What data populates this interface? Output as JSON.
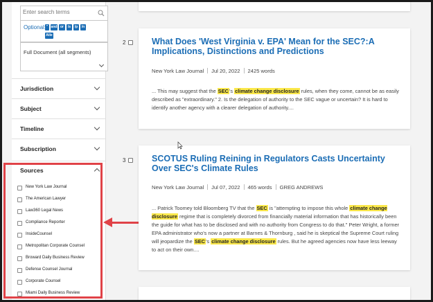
{
  "search": {
    "placeholder": "Enter search terms"
  },
  "operators": {
    "label": "Optional:",
    "chips": [
      "\"",
      "and",
      "or",
      "/s",
      "/p",
      "/n",
      "Atle"
    ]
  },
  "document_scope": {
    "selected": "Full Document (all segments)"
  },
  "facets": [
    "Jurisdiction",
    "Subject",
    "Timeline",
    "Subscription"
  ],
  "sources": {
    "title": "Sources",
    "items": [
      "New York Law Journal",
      "The American Lawyer",
      "Law360 Legal News",
      "Compliance Reporter",
      "InsideCounsel",
      "Metropolitan Corporate Counsel",
      "Broward Daily Business Review",
      "Defense Counsel Journal",
      "Corporate Counsel",
      "Miami Daily Business Review"
    ]
  },
  "results": [
    {
      "number": "2",
      "title": "What Does 'West Virginia v. EPA' Mean for the SEC?:A Implications, Distinctions and Predictions",
      "source": "New York Law Journal",
      "date": "Jul 20, 2022",
      "words": "2425 words",
      "author": "",
      "snippet": [
        {
          "t": "... This may suggest that the "
        },
        {
          "t": "SEC",
          "h": true
        },
        {
          "t": "'s "
        },
        {
          "t": "climate change disclosure",
          "h": true
        },
        {
          "t": " rules, when they come, cannot be as easily described as \"extraordinary.\" 2. Is the delegation of authority to the SEC vague or uncertain? It is hard to identify another agency with a clearer delegation of authority...."
        }
      ]
    },
    {
      "number": "3",
      "title": "SCOTUS Ruling Reining in Regulators Casts Uncertainty Over SEC's Climate Rules",
      "source": "New York Law Journal",
      "date": "Jul 07, 2022",
      "words": "465 words",
      "author": "GREG ANDREWS",
      "snippet": [
        {
          "t": "... Patrick Toomey told Bloomberg TV that the "
        },
        {
          "t": "SEC",
          "h": true
        },
        {
          "t": " is \"attempting to impose this whole "
        },
        {
          "t": "climate change disclosure",
          "h": true
        },
        {
          "t": " regime that is completely divorced from financially material information that has historically been the guide for what has to be disclosed and with no authority from Congress to do that.\" Peter Wright, a former EPA administrator who's now a partner at Barnes & Thornburg , said he is skeptical the Supreme Court ruling will jeopardize the "
        },
        {
          "t": "SEC",
          "h": true
        },
        {
          "t": "'s "
        },
        {
          "t": "climate change disclosure",
          "h": true
        },
        {
          "t": " rules. But he agreed agencies now have less leeway to act on their own...."
        }
      ]
    }
  ],
  "colors": {
    "link": "#1b6db5",
    "highlight": "#fbe84a",
    "annotation": "#e04247"
  }
}
